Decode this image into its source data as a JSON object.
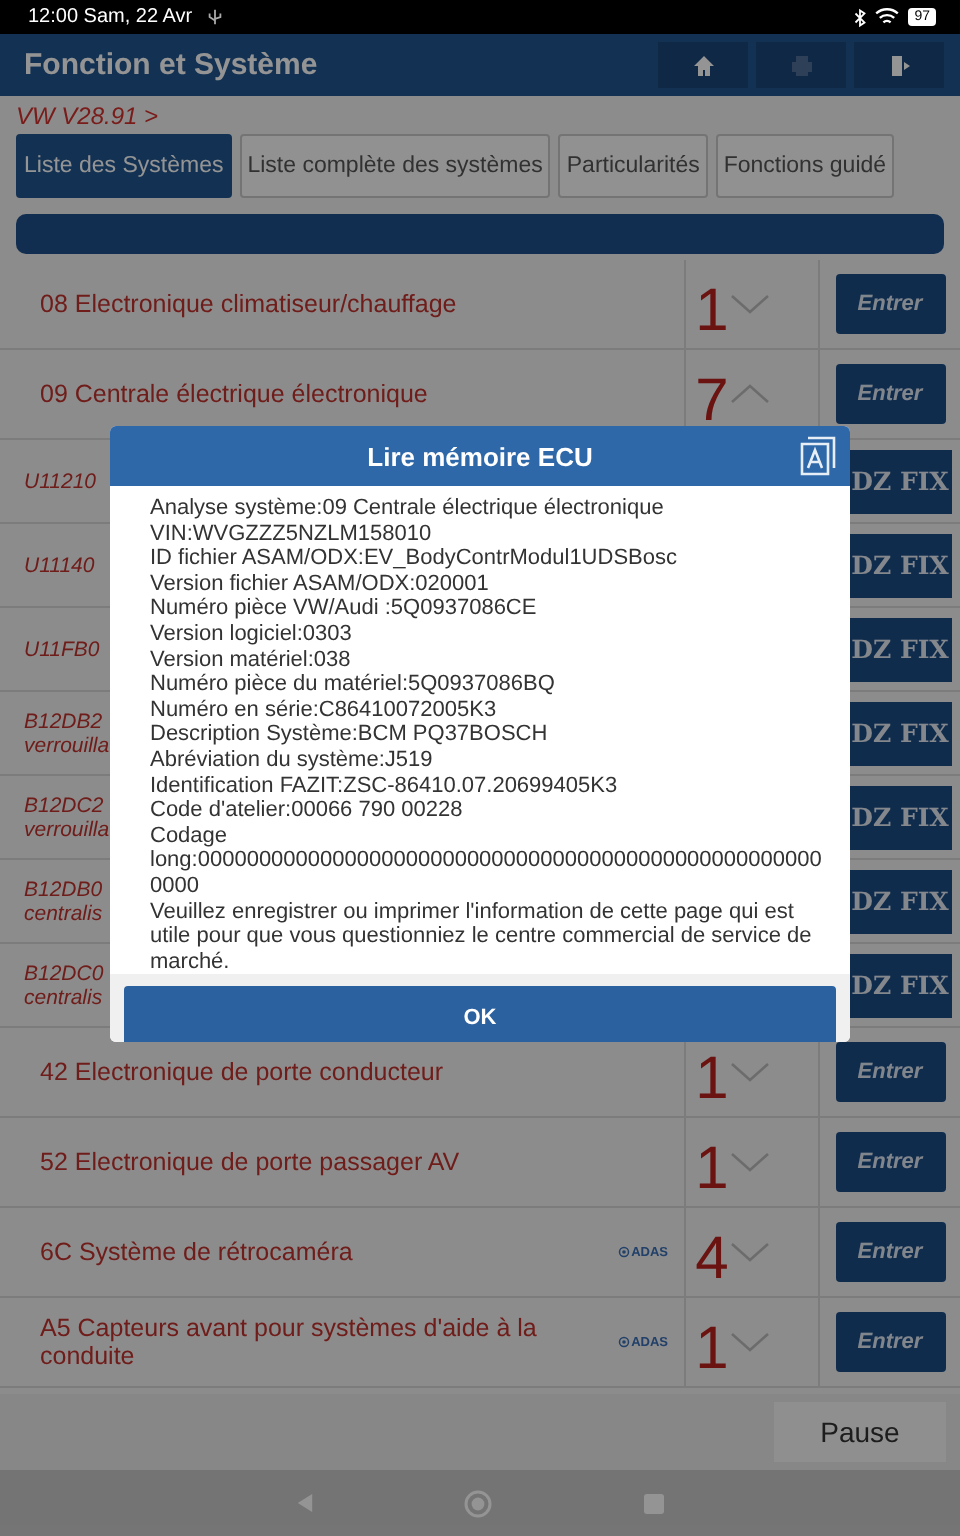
{
  "status_bar": {
    "time": "12:00 Sam, 22 Avr",
    "battery": "97"
  },
  "header": {
    "title": "Fonction et Système",
    "buttons": [
      {
        "kind": "home",
        "disabled": false
      },
      {
        "kind": "print",
        "disabled": true
      },
      {
        "kind": "exit",
        "disabled": false
      }
    ]
  },
  "breadcrumb": "VW V28.91 >",
  "tabs": [
    {
      "label": "Liste des Systèmes",
      "selected": true
    },
    {
      "label": "Liste complète des systèmes",
      "selected": false
    },
    {
      "label": "Particularités",
      "selected": false
    },
    {
      "label": "Fonctions guidé",
      "selected": false
    }
  ],
  "systems_top": [
    {
      "name": "08 Electronique climatiseur/chauffage",
      "count": "1",
      "expanded": false,
      "button": "Entrer"
    },
    {
      "name": "09 Centrale électrique électronique",
      "count": "7",
      "expanded": true,
      "button": "Entrer"
    }
  ],
  "faults": [
    {
      "code": "U11210",
      "button": "DZ FIX"
    },
    {
      "code": "U11140",
      "button": "DZ FIX"
    },
    {
      "code": "U11FB0",
      "button": "DZ FIX"
    },
    {
      "code": "B12DB2",
      "description": "verrouilla",
      "button": "DZ FIX"
    },
    {
      "code": "B12DC2",
      "description": "verrouilla",
      "button": "DZ FIX"
    },
    {
      "code": "B12DB0",
      "description": "centralis",
      "button": "DZ FIX"
    },
    {
      "code": "B12DC0",
      "description": "centralis",
      "button": "DZ FIX"
    }
  ],
  "systems_bottom": [
    {
      "name": "42 Electronique de porte conducteur",
      "count": "1",
      "expanded": false,
      "button": "Entrer"
    },
    {
      "name": "52 Electronique de porte passager AV",
      "count": "1",
      "expanded": false,
      "button": "Entrer"
    },
    {
      "name": "6C Système de rétrocaméra",
      "badge": "ADAS",
      "count": "4",
      "expanded": false,
      "button": "Entrer"
    },
    {
      "name": "A5 Capteurs avant pour systèmes d'aide à la conduite",
      "badge": "ADAS",
      "count": "1",
      "expanded": false,
      "button": "Entrer"
    }
  ],
  "pause_button": "Pause",
  "dialog": {
    "title": "Lire mémoire ECU",
    "lines": [
      "Analyse système:09 Centrale électrique électronique",
      "VIN:WVGZZZ5NZLM158010",
      "ID fichier ASAM/ODX:EV_BodyContrModul1UDSBosc",
      "Version fichier ASAM/ODX:020001",
      "Numéro pièce VW/Audi :5Q0937086CE",
      "Version logiciel:0303",
      "Version matériel:038",
      "Numéro pièce du matériel:5Q0937086BQ",
      "Numéro en série:C86410072005K3",
      "Description Système:BCM PQ37BOSCH",
      "Abréviation du système:J519",
      "Identification FAZIT:ZSC-86410.07.20699405K3",
      "Code d'atelier:00066  790  00228",
      "Codage long:0000000000000000000000000000000000000000000000000000000",
      "Veuillez enregistrer ou imprimer l'information de cette page qui est utile pour que vous questionniez le centre commercial de service de marché."
    ],
    "ok_button": "OK"
  }
}
